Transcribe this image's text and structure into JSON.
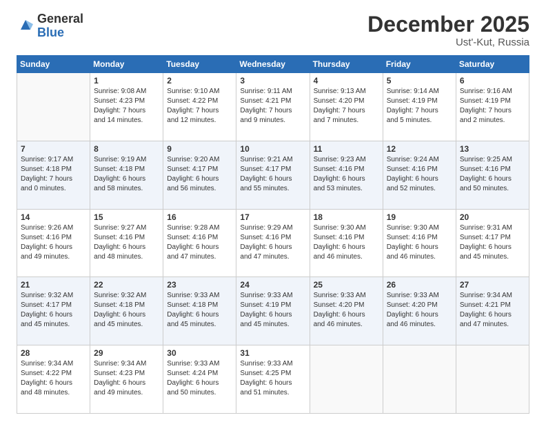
{
  "header": {
    "logo_general": "General",
    "logo_blue": "Blue",
    "month": "December 2025",
    "location": "Ust'-Kut, Russia"
  },
  "days_of_week": [
    "Sunday",
    "Monday",
    "Tuesday",
    "Wednesday",
    "Thursday",
    "Friday",
    "Saturday"
  ],
  "weeks": [
    [
      {
        "day": "",
        "content": ""
      },
      {
        "day": "1",
        "content": "Sunrise: 9:08 AM\nSunset: 4:23 PM\nDaylight: 7 hours\nand 14 minutes."
      },
      {
        "day": "2",
        "content": "Sunrise: 9:10 AM\nSunset: 4:22 PM\nDaylight: 7 hours\nand 12 minutes."
      },
      {
        "day": "3",
        "content": "Sunrise: 9:11 AM\nSunset: 4:21 PM\nDaylight: 7 hours\nand 9 minutes."
      },
      {
        "day": "4",
        "content": "Sunrise: 9:13 AM\nSunset: 4:20 PM\nDaylight: 7 hours\nand 7 minutes."
      },
      {
        "day": "5",
        "content": "Sunrise: 9:14 AM\nSunset: 4:19 PM\nDaylight: 7 hours\nand 5 minutes."
      },
      {
        "day": "6",
        "content": "Sunrise: 9:16 AM\nSunset: 4:19 PM\nDaylight: 7 hours\nand 2 minutes."
      }
    ],
    [
      {
        "day": "7",
        "content": "Sunrise: 9:17 AM\nSunset: 4:18 PM\nDaylight: 7 hours\nand 0 minutes."
      },
      {
        "day": "8",
        "content": "Sunrise: 9:19 AM\nSunset: 4:18 PM\nDaylight: 6 hours\nand 58 minutes."
      },
      {
        "day": "9",
        "content": "Sunrise: 9:20 AM\nSunset: 4:17 PM\nDaylight: 6 hours\nand 56 minutes."
      },
      {
        "day": "10",
        "content": "Sunrise: 9:21 AM\nSunset: 4:17 PM\nDaylight: 6 hours\nand 55 minutes."
      },
      {
        "day": "11",
        "content": "Sunrise: 9:23 AM\nSunset: 4:16 PM\nDaylight: 6 hours\nand 53 minutes."
      },
      {
        "day": "12",
        "content": "Sunrise: 9:24 AM\nSunset: 4:16 PM\nDaylight: 6 hours\nand 52 minutes."
      },
      {
        "day": "13",
        "content": "Sunrise: 9:25 AM\nSunset: 4:16 PM\nDaylight: 6 hours\nand 50 minutes."
      }
    ],
    [
      {
        "day": "14",
        "content": "Sunrise: 9:26 AM\nSunset: 4:16 PM\nDaylight: 6 hours\nand 49 minutes."
      },
      {
        "day": "15",
        "content": "Sunrise: 9:27 AM\nSunset: 4:16 PM\nDaylight: 6 hours\nand 48 minutes."
      },
      {
        "day": "16",
        "content": "Sunrise: 9:28 AM\nSunset: 4:16 PM\nDaylight: 6 hours\nand 47 minutes."
      },
      {
        "day": "17",
        "content": "Sunrise: 9:29 AM\nSunset: 4:16 PM\nDaylight: 6 hours\nand 47 minutes."
      },
      {
        "day": "18",
        "content": "Sunrise: 9:30 AM\nSunset: 4:16 PM\nDaylight: 6 hours\nand 46 minutes."
      },
      {
        "day": "19",
        "content": "Sunrise: 9:30 AM\nSunset: 4:16 PM\nDaylight: 6 hours\nand 46 minutes."
      },
      {
        "day": "20",
        "content": "Sunrise: 9:31 AM\nSunset: 4:17 PM\nDaylight: 6 hours\nand 45 minutes."
      }
    ],
    [
      {
        "day": "21",
        "content": "Sunrise: 9:32 AM\nSunset: 4:17 PM\nDaylight: 6 hours\nand 45 minutes."
      },
      {
        "day": "22",
        "content": "Sunrise: 9:32 AM\nSunset: 4:18 PM\nDaylight: 6 hours\nand 45 minutes."
      },
      {
        "day": "23",
        "content": "Sunrise: 9:33 AM\nSunset: 4:18 PM\nDaylight: 6 hours\nand 45 minutes."
      },
      {
        "day": "24",
        "content": "Sunrise: 9:33 AM\nSunset: 4:19 PM\nDaylight: 6 hours\nand 45 minutes."
      },
      {
        "day": "25",
        "content": "Sunrise: 9:33 AM\nSunset: 4:20 PM\nDaylight: 6 hours\nand 46 minutes."
      },
      {
        "day": "26",
        "content": "Sunrise: 9:33 AM\nSunset: 4:20 PM\nDaylight: 6 hours\nand 46 minutes."
      },
      {
        "day": "27",
        "content": "Sunrise: 9:34 AM\nSunset: 4:21 PM\nDaylight: 6 hours\nand 47 minutes."
      }
    ],
    [
      {
        "day": "28",
        "content": "Sunrise: 9:34 AM\nSunset: 4:22 PM\nDaylight: 6 hours\nand 48 minutes."
      },
      {
        "day": "29",
        "content": "Sunrise: 9:34 AM\nSunset: 4:23 PM\nDaylight: 6 hours\nand 49 minutes."
      },
      {
        "day": "30",
        "content": "Sunrise: 9:33 AM\nSunset: 4:24 PM\nDaylight: 6 hours\nand 50 minutes."
      },
      {
        "day": "31",
        "content": "Sunrise: 9:33 AM\nSunset: 4:25 PM\nDaylight: 6 hours\nand 51 minutes."
      },
      {
        "day": "",
        "content": ""
      },
      {
        "day": "",
        "content": ""
      },
      {
        "day": "",
        "content": ""
      }
    ]
  ]
}
